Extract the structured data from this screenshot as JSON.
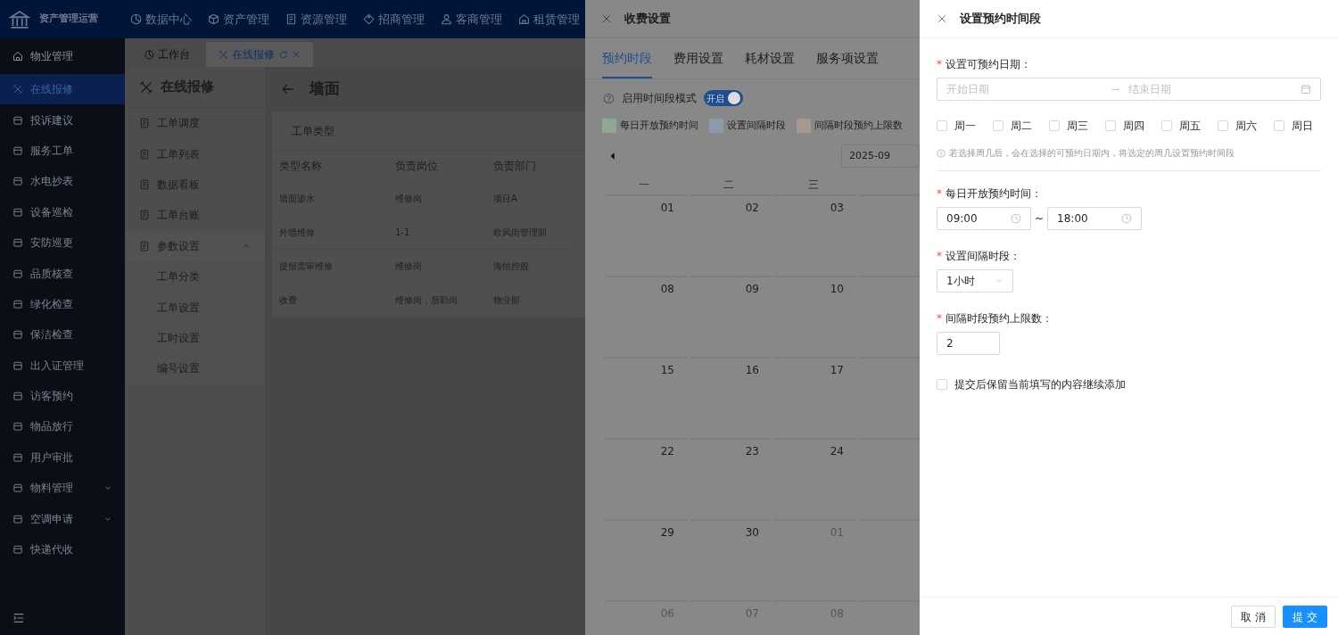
{
  "top_nav": {
    "app_title": "资产管理运营",
    "items": [
      {
        "label": "数据中心"
      },
      {
        "label": "资产管理"
      },
      {
        "label": "资源管理"
      },
      {
        "label": "招商管理"
      },
      {
        "label": "客商管理"
      },
      {
        "label": "租赁管理"
      }
    ]
  },
  "sidebar": {
    "section": "物业管理",
    "items": [
      {
        "label": "在线报修",
        "selected": true,
        "kind": "link"
      },
      {
        "label": "投诉建议",
        "selected": false,
        "kind": "link"
      },
      {
        "label": "服务工单",
        "selected": false,
        "kind": "link"
      },
      {
        "label": "水电抄表",
        "selected": false,
        "kind": "link"
      },
      {
        "label": "设备巡检",
        "selected": false,
        "kind": "link"
      },
      {
        "label": "安防巡更",
        "selected": false,
        "kind": "link"
      },
      {
        "label": "品质核查",
        "selected": false,
        "kind": "link"
      },
      {
        "label": "绿化检查",
        "selected": false,
        "kind": "link"
      },
      {
        "label": "保洁检查",
        "selected": false,
        "kind": "link"
      },
      {
        "label": "出入证管理",
        "selected": false,
        "kind": "link"
      },
      {
        "label": "访客预约",
        "selected": false,
        "kind": "link"
      },
      {
        "label": "物品放行",
        "selected": false,
        "kind": "link"
      },
      {
        "label": "用户审批",
        "selected": false,
        "kind": "link"
      },
      {
        "label": "物料管理",
        "selected": false,
        "kind": "group"
      },
      {
        "label": "空调申请",
        "selected": false,
        "kind": "group"
      },
      {
        "label": "快递代收",
        "selected": false,
        "kind": "link"
      }
    ]
  },
  "page_tabs": [
    {
      "label": "工作台",
      "selected": false
    },
    {
      "label": "在线报修",
      "selected": true
    }
  ],
  "submenu": {
    "title": "在线报修",
    "items": [
      {
        "label": "工单调度"
      },
      {
        "label": "工单列表"
      },
      {
        "label": "数据看板"
      },
      {
        "label": "工单台账"
      },
      {
        "label": "参数设置",
        "expanded": true,
        "children": [
          {
            "label": "工单分类"
          },
          {
            "label": "工单设置"
          },
          {
            "label": "工时设置"
          },
          {
            "label": "编号设置"
          }
        ]
      }
    ]
  },
  "page": {
    "title": "墙面",
    "card_title": "工单类型",
    "table": {
      "columns": [
        "类型名称",
        "负责岗位",
        "负责部门"
      ],
      "rows": [
        [
          "墙面渗水",
          "维修岗",
          "项目A"
        ],
        [
          "外墙维修",
          "1-1",
          "欧风街管理部"
        ],
        [
          "提报需审维修",
          "维修岗",
          "海恒控股"
        ],
        [
          "收费",
          "维修岗，后勤岗",
          "物业部"
        ]
      ]
    }
  },
  "fee_drawer": {
    "title": "收费设置",
    "tabs": [
      {
        "label": "预约时段",
        "selected": true
      },
      {
        "label": "费用设置",
        "selected": false
      },
      {
        "label": "耗材设置",
        "selected": false
      },
      {
        "label": "服务项设置",
        "selected": false
      }
    ],
    "time_mode": {
      "label": "启用时间段模式",
      "on": true,
      "switch_text": "开启"
    },
    "legend": [
      {
        "label": "每日开放预约时间",
        "color": "#8fa893"
      },
      {
        "label": "设置间隔时段",
        "color": "#8b9aab"
      },
      {
        "label": "间隔时段预约上限数",
        "color": "#a8978c"
      }
    ],
    "calendar": {
      "month": "2025-09",
      "weekdays": [
        "一",
        "二",
        "三"
      ],
      "weeks": [
        [
          {
            "day": "01",
            "in_month": true
          },
          {
            "day": "02",
            "in_month": true
          },
          {
            "day": "03",
            "in_month": true
          }
        ],
        [
          {
            "day": "08",
            "in_month": true
          },
          {
            "day": "09",
            "in_month": true
          },
          {
            "day": "10",
            "in_month": true
          }
        ],
        [
          {
            "day": "15",
            "in_month": true
          },
          {
            "day": "16",
            "in_month": true
          },
          {
            "day": "17",
            "in_month": true
          }
        ],
        [
          {
            "day": "22",
            "in_month": true
          },
          {
            "day": "23",
            "in_month": true
          },
          {
            "day": "24",
            "in_month": true
          }
        ],
        [
          {
            "day": "29",
            "in_month": true
          },
          {
            "day": "30",
            "in_month": true
          },
          {
            "day": "01",
            "in_month": false
          }
        ],
        [
          {
            "day": "06",
            "in_month": false
          },
          {
            "day": "07",
            "in_month": false
          },
          {
            "day": "08",
            "in_month": false
          }
        ]
      ]
    }
  },
  "slot_drawer": {
    "title": "设置预约时间段",
    "date_range": {
      "marker": "*",
      "label": "设置可预约日期：",
      "start_placeholder": "开始日期",
      "end_placeholder": "结束日期"
    },
    "weekdays": [
      {
        "label": "周一",
        "checked": false
      },
      {
        "label": "周二",
        "checked": false
      },
      {
        "label": "周三",
        "checked": false
      },
      {
        "label": "周四",
        "checked": false
      },
      {
        "label": "周五",
        "checked": false
      },
      {
        "label": "周六",
        "checked": false
      },
      {
        "label": "周日",
        "checked": false
      }
    ],
    "hint": "若选择周几后，会在选择的可预约日期内，将选定的周几设置预约时间段",
    "open_time": {
      "marker": "*",
      "label": "每日开放预约时间：",
      "start": "09:00",
      "separator": "~",
      "end": "18:00"
    },
    "interval": {
      "marker": "*",
      "label": "设置间隔时段：",
      "value": "1小时"
    },
    "limit": {
      "marker": "*",
      "label": "间隔时段预约上限数：",
      "value": "2"
    },
    "keep": {
      "label": "提交后保留当前填写的内容继续添加",
      "checked": false
    },
    "buttons": [
      {
        "label": "取 消",
        "kind": "default"
      },
      {
        "label": "提 交",
        "kind": "primary"
      }
    ]
  }
}
